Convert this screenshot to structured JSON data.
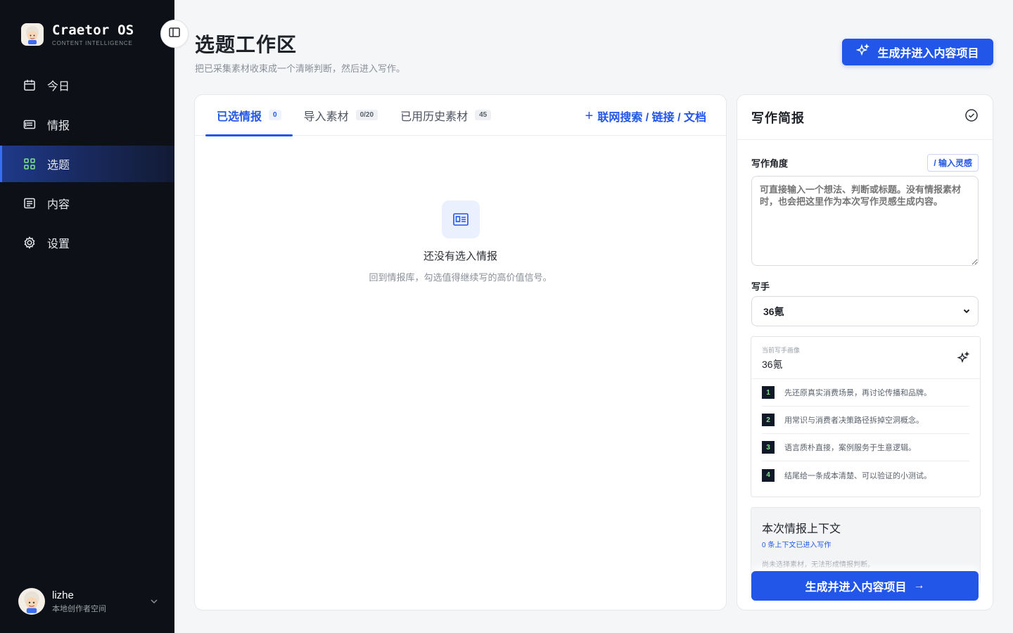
{
  "brand": {
    "name": "Craetor OS",
    "subtitle": "CONTENT INTELLIGENCE"
  },
  "nav": [
    {
      "label": "今日",
      "icon": "calendar-icon"
    },
    {
      "label": "情报",
      "icon": "newspaper-icon"
    },
    {
      "label": "选题",
      "icon": "grid-icon",
      "active": true
    },
    {
      "label": "内容",
      "icon": "document-icon"
    },
    {
      "label": "设置",
      "icon": "gear-icon"
    }
  ],
  "user": {
    "name": "lizhe",
    "subtitle": "本地创作者空间"
  },
  "header": {
    "title": "选题工作区",
    "subtitle": "把已采集素材收束成一个清晰判断，然后进入写作。",
    "primary_button": "生成并进入内容项目"
  },
  "tabs": [
    {
      "label": "已选情报",
      "badge": "0",
      "active": true
    },
    {
      "label": "导入素材",
      "badge": "0/20"
    },
    {
      "label": "已用历史素材",
      "badge": "45"
    }
  ],
  "web_search": {
    "label": "联网搜索 / 链接 / 文档"
  },
  "empty_state": {
    "title": "还没有选入情报",
    "subtitle": "回到情报库，勾选值得继续写的高价值信号。"
  },
  "brief": {
    "title": "写作简报",
    "angle_label": "写作角度",
    "inspire_button": "/ 输入灵感",
    "angle_placeholder": "可直接输入一个想法、判断或标题。没有情报素材时，也会把这里作为本次写作灵感生成内容。",
    "writer_label": "写手",
    "writer_value": "36氪",
    "profile_caption": "当前写手画像",
    "profile_name": "36氪",
    "rules": [
      {
        "num": "1",
        "text": "先还原真实消费场景，再讨论传播和品牌。"
      },
      {
        "num": "2",
        "text": "用常识与消费者决策路径拆掉空洞概念。"
      },
      {
        "num": "3",
        "text": "语言质朴直接，案例服务于生意逻辑。"
      },
      {
        "num": "4",
        "text": "结尾给一条成本清楚、可以验证的小测试。"
      }
    ],
    "context_title": "本次情报上下文",
    "context_link": "0 条上下文已进入写作",
    "context_note": "尚未选择素材，无法形成情报判断。",
    "primary_button": "生成并进入内容项目",
    "primary_arrow": "→"
  },
  "colors": {
    "accent": "#2256e8",
    "sidebar_bg": "#0d1117",
    "page_bg": "#f5f6f8"
  }
}
